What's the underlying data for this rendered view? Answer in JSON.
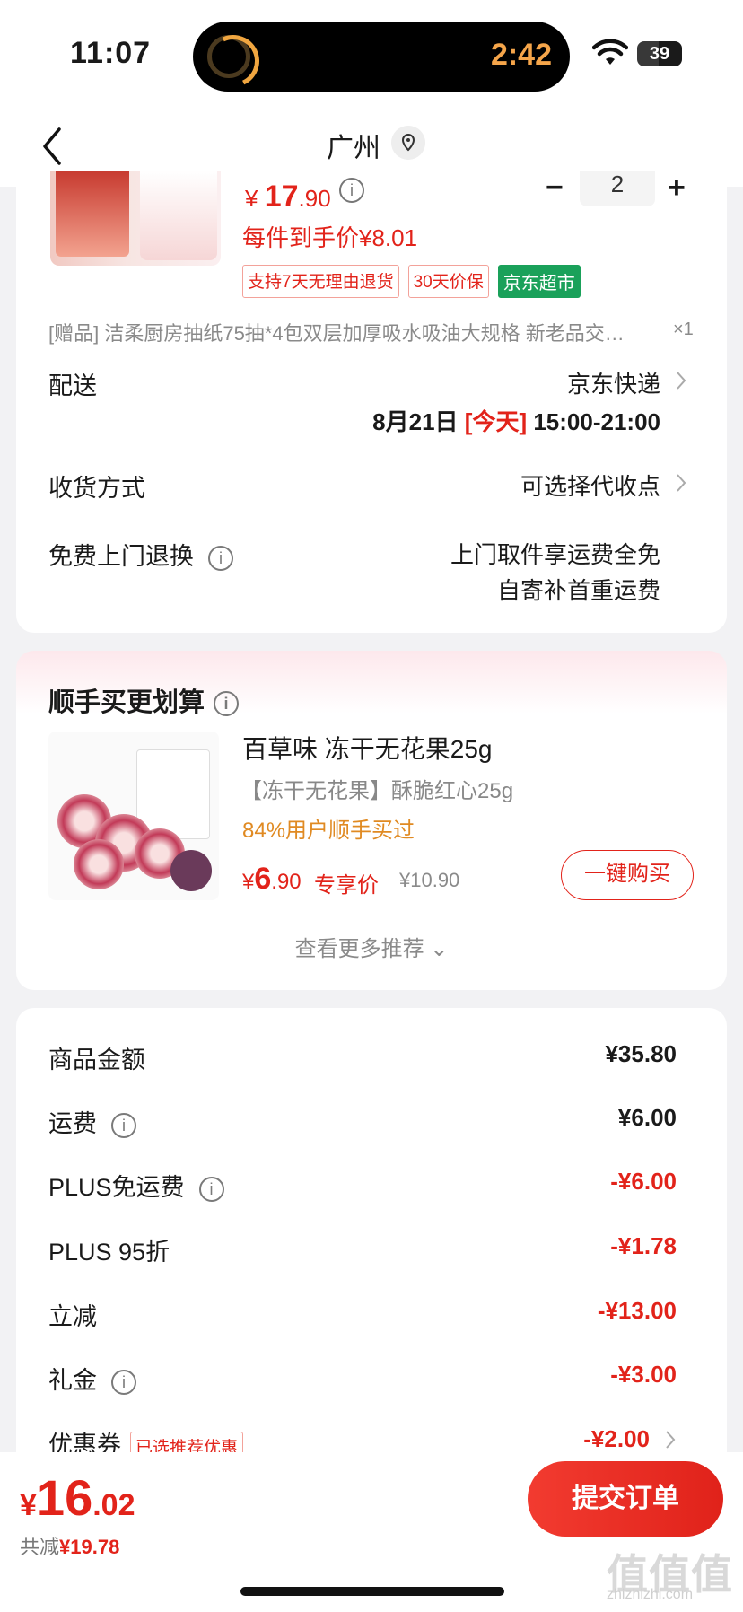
{
  "status": {
    "time": "11:07",
    "island_timer": "2:42",
    "battery": "39"
  },
  "nav": {
    "title": "广州"
  },
  "item": {
    "price_symbol": "¥",
    "price_int": "17",
    "price_dec": ".90",
    "quantity": "2",
    "unit_price": "每件到手价¥8.01",
    "tags": [
      "支持7天无理由退货",
      "30天价保",
      "京东超市"
    ],
    "gift": "[赠品] 洁柔厨房抽纸75抽*4包双层加厚吸水吸油大规格 新老品交…",
    "gift_qty": "×1"
  },
  "delivery": {
    "label": "配送",
    "carrier": "京东快递",
    "date": "8月21日",
    "today": "[今天]",
    "window": "15:00-21:00"
  },
  "receive": {
    "label": "收货方式",
    "value": "可选择代收点"
  },
  "returns": {
    "label": "免费上门退换",
    "line1": "上门取件享运费全免",
    "line2": "自寄补首重运费"
  },
  "recommend": {
    "title": "顺手买更划算",
    "name": "百草味 冻干无花果25g",
    "sub": "【冻干无花果】酥脆红心25g",
    "rate": "84%用户顺手买过",
    "price_symbol": "¥",
    "price_int": "6",
    "price_dec": ".90",
    "price_tag": "专享价",
    "old_price": "¥10.90",
    "buy_label": "一键购买",
    "more": "查看更多推荐"
  },
  "summary": {
    "rows": [
      {
        "label": "商品金额",
        "value": "¥35.80"
      },
      {
        "label": "运费",
        "value": "¥6.00"
      },
      {
        "label": "PLUS免运费",
        "value": "-¥6.00"
      },
      {
        "label": "PLUS 95折",
        "value": "-¥1.78"
      },
      {
        "label": "立减",
        "value": "-¥13.00"
      },
      {
        "label": "礼金",
        "value": "-¥3.00"
      },
      {
        "label": "优惠券",
        "value": "-¥2.00"
      }
    ],
    "coupon_tag": "已选推荐优惠"
  },
  "footer": {
    "total_symbol": "¥",
    "total_int": "16",
    "total_dec": ".02",
    "saved_label": "共减",
    "saved_value": "¥19.78",
    "submit": "提交订单",
    "watermark": "值值值",
    "watermark_url": "zhizhizhi.com"
  },
  "colors": {
    "accent": "#e2231a",
    "green": "#1aa15a",
    "orange": "#e08a22"
  }
}
